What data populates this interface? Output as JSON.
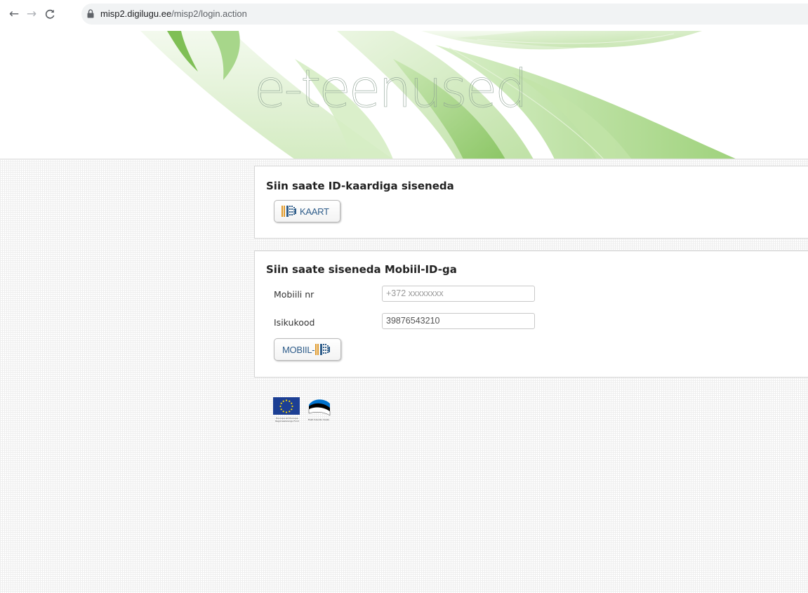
{
  "browser": {
    "url_domain": "misp2.digilugu.ee",
    "url_path": "/misp2/login.action",
    "back_icon": "←",
    "forward_icon": "→",
    "reload_icon": "C"
  },
  "header": {
    "title": "e-teenused"
  },
  "id_card_section": {
    "title": "Siin saate ID-kaardiga siseneda",
    "button_label": "KAART"
  },
  "mobile_id_section": {
    "title": "Siin saate siseneda Mobiil-ID-ga",
    "phone_label": "Mobiili nr",
    "phone_placeholder": "+372 xxxxxxxx",
    "id_code_label": "Isikukood",
    "id_code_value": "39876543210",
    "button_label": "MOBIIL-"
  },
  "footer": {
    "eu_logo_caption": "Euroopa Liit Euroopa Regionaalarengu Fond",
    "ee_logo_caption": "Eesti tuleviku heaks"
  },
  "colors": {
    "accent_blue": "#2f5d8a",
    "leaf_green": "#8fc96b",
    "eu_blue": "#1c3f94",
    "eu_star": "#ffdd00"
  }
}
